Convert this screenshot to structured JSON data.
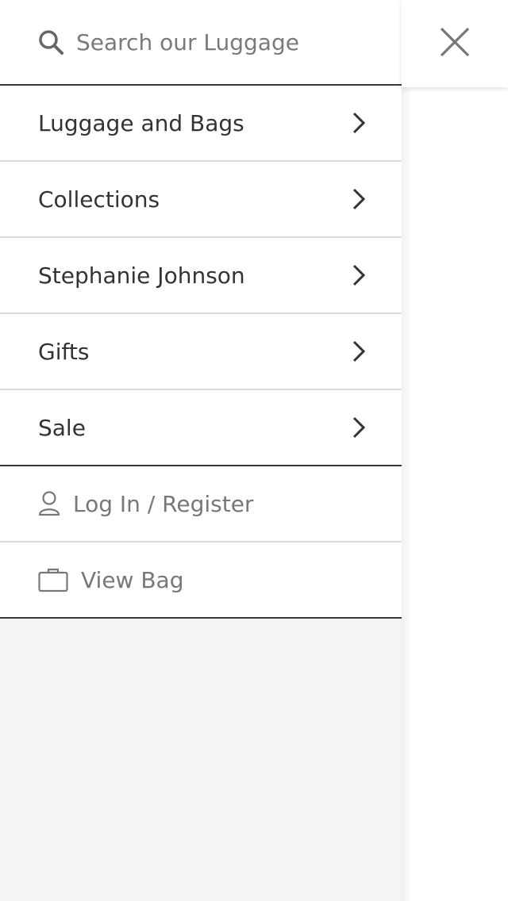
{
  "search": {
    "placeholder": "Search our Luggage",
    "value": "",
    "icon": "search-icon"
  },
  "menu": {
    "items": [
      {
        "label": "Luggage and Bags",
        "icon": "chevron-right-icon"
      },
      {
        "label": "Collections",
        "icon": "chevron-right-icon"
      },
      {
        "label": "Stephanie Johnson",
        "icon": "chevron-right-icon"
      },
      {
        "label": "Gifts",
        "icon": "chevron-right-icon"
      },
      {
        "label": "Sale",
        "icon": "chevron-right-icon"
      }
    ]
  },
  "account": {
    "login_label": "Log In / Register",
    "login_icon": "user-icon",
    "bag_label": "View Bag",
    "bag_icon": "bag-icon"
  },
  "close": {
    "icon": "close-icon"
  },
  "colors": {
    "drawer_background": "#ffffff",
    "empty_area": "#f4f4f4",
    "primary_text": "#333333",
    "secondary_text": "#777777",
    "strong_divider": "#3a3a3a",
    "light_divider": "#dcdcdc"
  }
}
